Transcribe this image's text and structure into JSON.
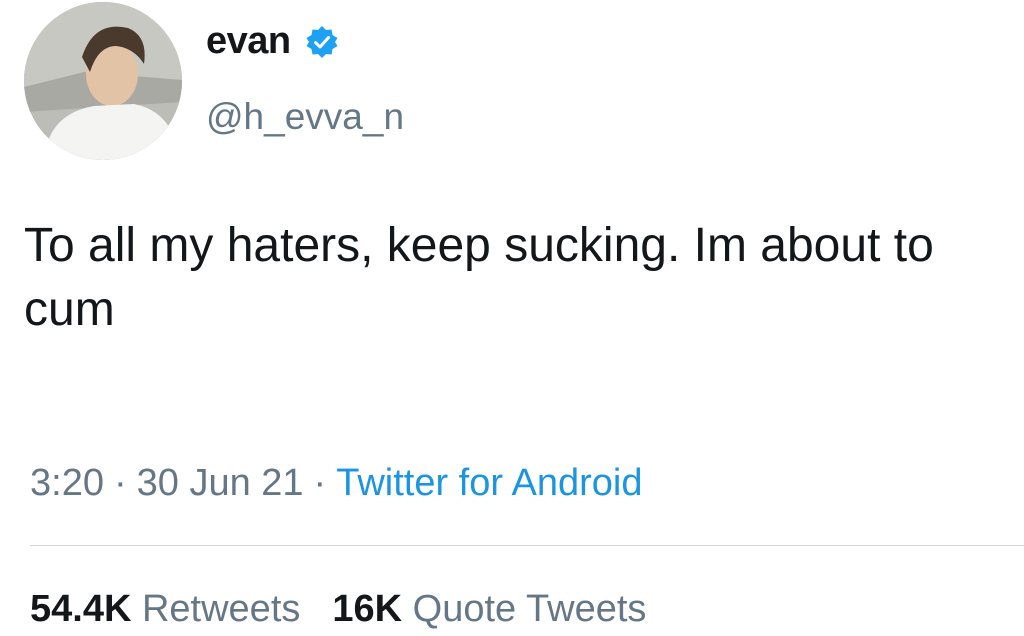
{
  "user": {
    "display_name": "evan",
    "handle": "@h_evva_n",
    "verified": true,
    "avatar_icon": "profile-photo",
    "verified_icon": "verified-badge-icon"
  },
  "tweet": {
    "text": "To all my haters, keep sucking. Im about to cum"
  },
  "meta": {
    "time": "3:20",
    "separator": "·",
    "date": "30 Jun 21",
    "source": "Twitter for Android"
  },
  "stats": {
    "retweets_count": "54.4K",
    "retweets_label": "Retweets",
    "quotes_count": "16K",
    "quotes_label": "Quote Tweets"
  },
  "colors": {
    "text": "#14171a",
    "secondary": "#657786",
    "link": "#1b95e0",
    "verified": "#1da1f2",
    "divider": "#d5d9dc"
  }
}
